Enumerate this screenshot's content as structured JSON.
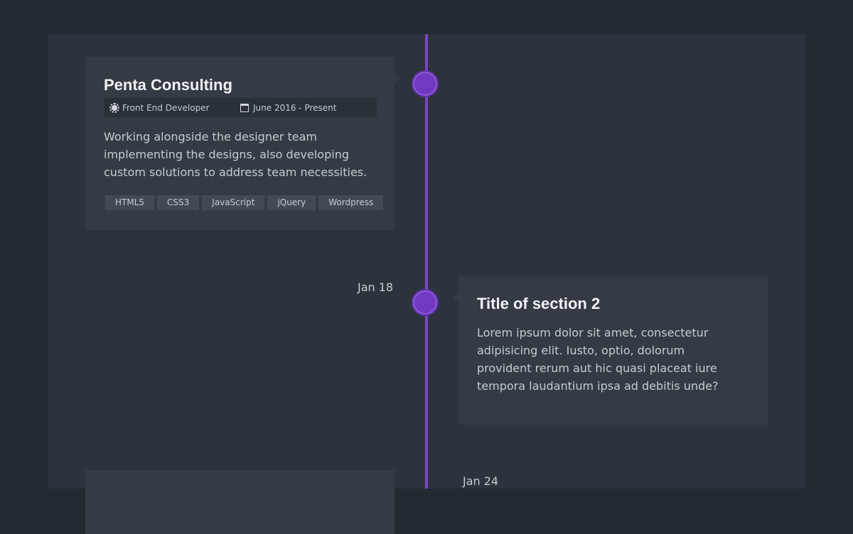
{
  "timeline": {
    "accent_color": "#7a45c4",
    "items": [
      {
        "company": "Penta Consulting",
        "role": "Front End Developer",
        "period": "June 2016 - Present",
        "description": "Working alongside the designer team implementing the designs, also developing custom solutions to address team necessities.",
        "tags": [
          "HTML5",
          "CSS3",
          "JavaScript",
          "jQuery",
          "Wordpress"
        ],
        "icons": [
          "cog-icon",
          "calendar-icon"
        ]
      },
      {
        "date": "Jan 18",
        "title": "Title of section 2",
        "text": "Lorem ipsum dolor sit amet, consectetur adipisicing elit. Iusto, optio, dolorum provident rerum aut hic quasi placeat iure tempora laudantium ipsa ad debitis unde?"
      },
      {
        "date": "Jan 24"
      }
    ]
  }
}
